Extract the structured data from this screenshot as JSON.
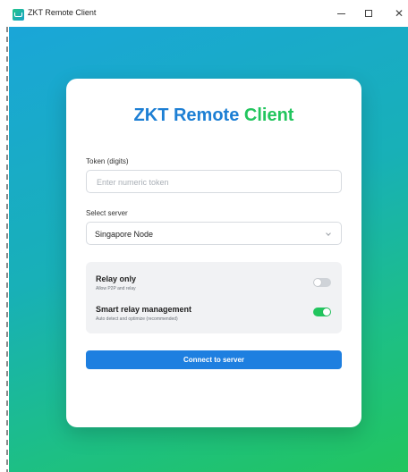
{
  "window": {
    "title": "ZKT Remote Client",
    "controls": {
      "minimize": "minimize",
      "maximize": "maximize",
      "close": "close"
    }
  },
  "card": {
    "title_part1": "ZKT Remote",
    "title_part2": "Client",
    "token_label": "Token (digits)",
    "token_placeholder": "Enter numeric token",
    "token_value": "",
    "server_label": "Select server",
    "server_selected": "Singapore Node",
    "options": [
      {
        "title": "Relay only",
        "subtitle": "Allow P2P and relay",
        "enabled": false
      },
      {
        "title": "Smart relay management",
        "subtitle": "Auto detect and optimize (recommended)",
        "enabled": true
      }
    ],
    "connect_label": "Connect to server"
  },
  "colors": {
    "accent_blue": "#1e7fe0",
    "accent_green": "#22c55e",
    "background_gradient_start": "#1aa6d8",
    "background_gradient_end": "#22c55e"
  },
  "icons": {
    "app": "remote-client-app-icon",
    "select": "chevron-down-icon"
  }
}
